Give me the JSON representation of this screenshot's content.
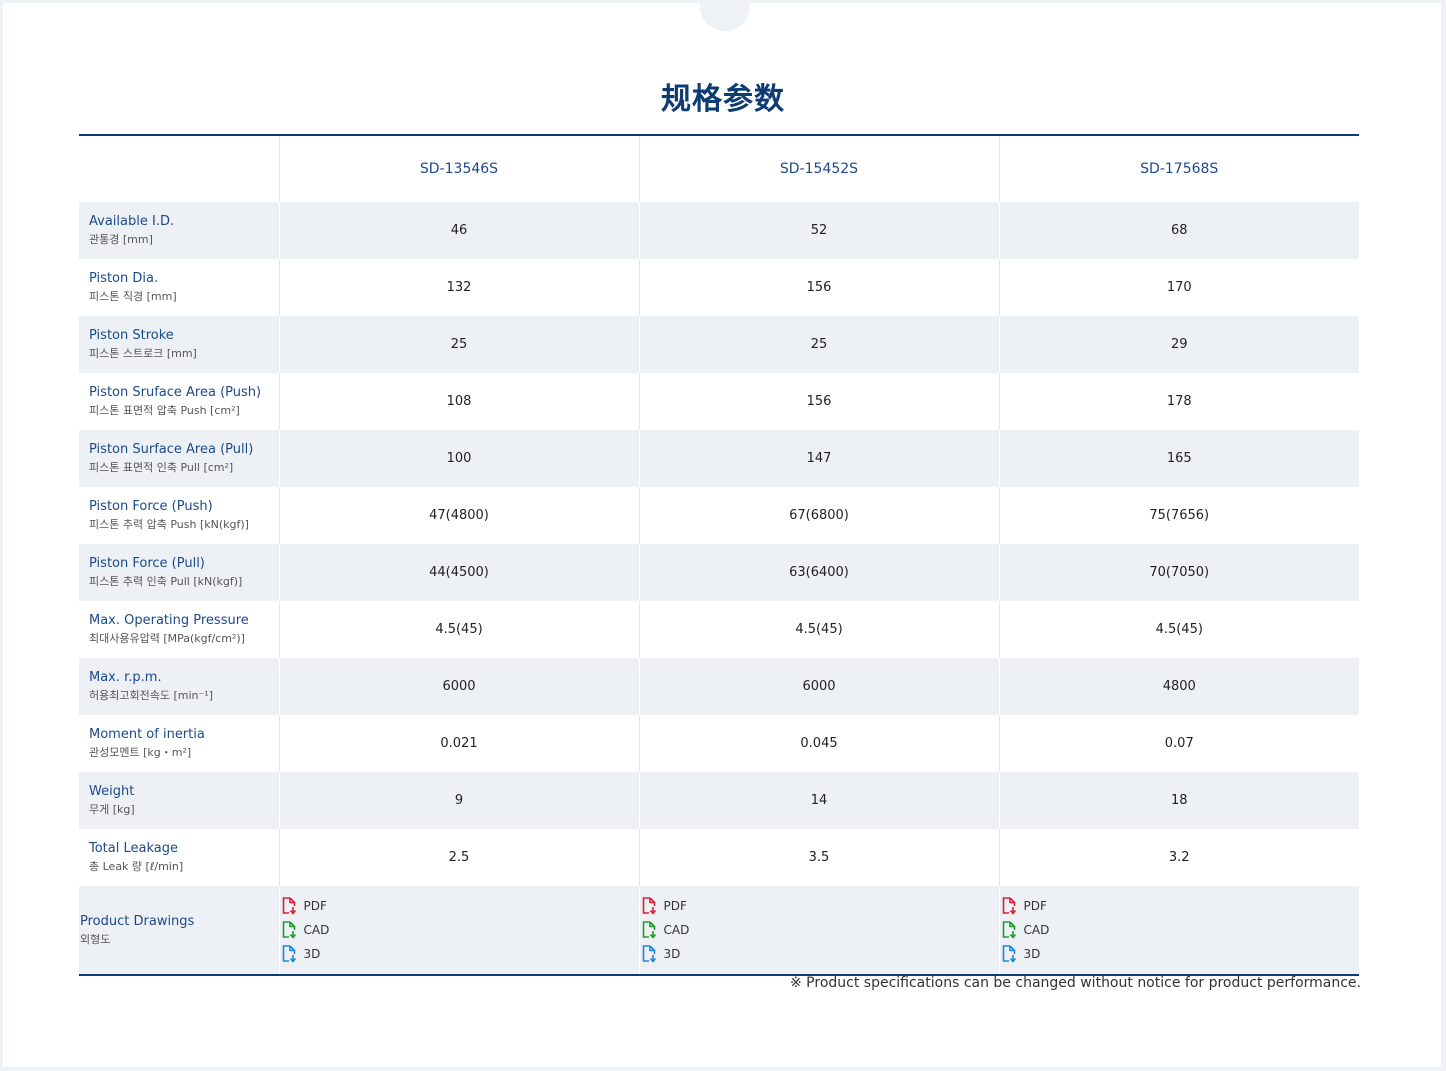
{
  "title": "规格参数",
  "models": [
    "SD-13546S",
    "SD-15452S",
    "SD-17568S"
  ],
  "rows": [
    {
      "en": "Available I.D.",
      "ko": "관통경 [mm]",
      "values": [
        "46",
        "52",
        "68"
      ]
    },
    {
      "en": "Piston Dia.",
      "ko": "피스톤 직경 [mm]",
      "values": [
        "132",
        "156",
        "170"
      ]
    },
    {
      "en": "Piston Stroke",
      "ko": "피스톤 스트로크 [mm]",
      "values": [
        "25",
        "25",
        "29"
      ]
    },
    {
      "en": "Piston Sruface Area (Push)",
      "ko": "피스톤 표면적 압축 Push [cm²]",
      "values": [
        "108",
        "156",
        "178"
      ]
    },
    {
      "en": "Piston Surface Area (Pull)",
      "ko": "피스톤 표면적 인축 Pull [cm²]",
      "values": [
        "100",
        "147",
        "165"
      ]
    },
    {
      "en": "Piston Force (Push)",
      "ko": "피스톤 추력 압축 Push [kN(kgf)]",
      "values": [
        "47(4800)",
        "67(6800)",
        "75(7656)"
      ]
    },
    {
      "en": "Piston Force (Pull)",
      "ko": "피스톤 추력 인축 Pull [kN(kgf)]",
      "values": [
        "44(4500)",
        "63(6400)",
        "70(7050)"
      ]
    },
    {
      "en": "Max. Operating Pressure",
      "ko": "최대사용유압력 [MPa(kgf/cm²)]",
      "values": [
        "4.5(45)",
        "4.5(45)",
        "4.5(45)"
      ]
    },
    {
      "en": "Max. r.p.m.",
      "ko": "허용최고회전속도 [min⁻¹]",
      "values": [
        "6000",
        "6000",
        "4800"
      ]
    },
    {
      "en": "Moment of inertia",
      "ko": "관성모멘트 [kg・m²]",
      "values": [
        "0.021",
        "0.045",
        "0.07"
      ]
    },
    {
      "en": "Weight",
      "ko": "무게 [kg]",
      "values": [
        "9",
        "14",
        "18"
      ]
    },
    {
      "en": "Total Leakage",
      "ko": "총 Leak 량 [ℓ/min]",
      "values": [
        "2.5",
        "3.5",
        "3.2"
      ]
    }
  ],
  "drawings": {
    "en": "Product Drawings",
    "ko": "외형도",
    "links": [
      {
        "label": "PDF",
        "icon": "pdf-download-icon",
        "color": "#d8203c"
      },
      {
        "label": "CAD",
        "icon": "cad-download-icon",
        "color": "#1e9e2b"
      },
      {
        "label": "3D",
        "icon": "3d-download-icon",
        "color": "#1f86d6"
      }
    ]
  },
  "note": "※ Product specifications can be changed without notice for product performance."
}
